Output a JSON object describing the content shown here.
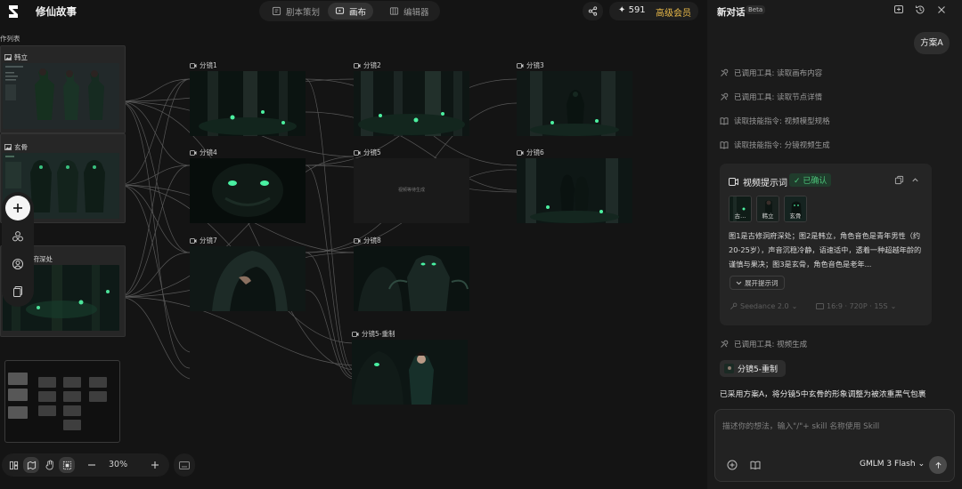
{
  "header": {
    "app_title": "修仙故事",
    "tabs": [
      {
        "label": "剧本策划",
        "icon": "script-icon",
        "active": false
      },
      {
        "label": "画布",
        "icon": "canvas-icon",
        "active": true
      },
      {
        "label": "编辑器",
        "icon": "editor-icon",
        "active": false
      }
    ],
    "credits": "591",
    "vip_label": "高级会员"
  },
  "canvas": {
    "list_title": "作列表",
    "assets": [
      {
        "label": "韩立"
      },
      {
        "label": "玄骨"
      },
      {
        "label": "洞府深处"
      }
    ],
    "nodes": [
      {
        "label": "分镜1"
      },
      {
        "label": "分镜2"
      },
      {
        "label": "分镜3"
      },
      {
        "label": "分镜4"
      },
      {
        "label": "分镜5",
        "placeholder": "视频等待生成"
      },
      {
        "label": "分镜6"
      },
      {
        "label": "分镜7"
      },
      {
        "label": "分镜8"
      },
      {
        "label": "分镜5-重制"
      }
    ],
    "zoom": "30%"
  },
  "chat": {
    "title": "新对话",
    "beta": "Beta",
    "user_message": "方案A",
    "tool_calls": [
      {
        "text": "已调用工具:  读取画布内容",
        "icon": "tool-icon"
      },
      {
        "text": "已调用工具:  读取节点详情",
        "icon": "tool-icon"
      },
      {
        "text": "读取技能指令:  视频模型规格",
        "icon": "book-icon"
      },
      {
        "text": "读取技能指令:  分镜视频生成",
        "icon": "book-icon"
      }
    ],
    "prompt_card": {
      "title": "视频提示词",
      "status": "✓ 已确认",
      "refs": [
        "古...",
        "韩立",
        "玄骨"
      ],
      "text": "图1是古修洞府深处；图2是韩立，角色音色是青年男性（约20-25岁），声音沉稳冷静，语速适中，透着一种超越年龄的谨慎与果决；图3是玄骨，角色音色是老年...",
      "expand_label": "展开提示词",
      "model": "Seedance 2.0",
      "spec": "16:9 · 720P · 15S"
    },
    "tool_call_after": "已调用工具:  视频生成",
    "result_chip": "分镜5-重制",
    "result_text": "已采用方案A，将分镜5中玄骨的形象调整为被浓重黑气包裹",
    "input_placeholder": "描述你的想法，输入\"/\"+ skill 名称使用 Skill",
    "model_select": "GMLM 3 Flash"
  }
}
